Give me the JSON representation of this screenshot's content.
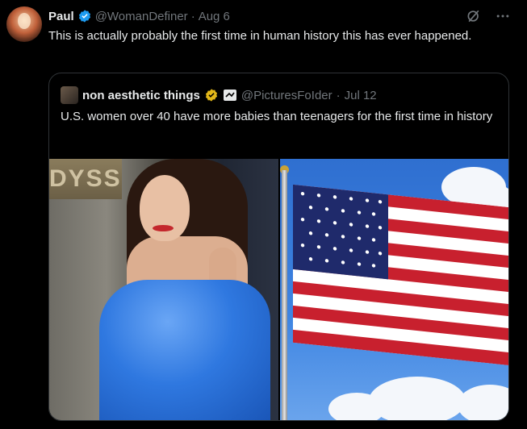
{
  "tweet": {
    "name": "Paul",
    "handle": "@WomanDefiner",
    "separator": "·",
    "date": "Aug 6",
    "text": "This is actually probably the first time in human history this has ever happened."
  },
  "quote": {
    "name": "non aesthetic things",
    "handle": "@PicturesFoIder",
    "separator": "·",
    "date": "Jul 12",
    "text": "U.S. women over 40 have more babies than teenagers for the first time in history",
    "sign_text": "DYSSEI"
  },
  "icons": {
    "verified_color_user": "#1d9bf0",
    "verified_color_quote": "#e2b719",
    "top_icons": [
      "grok-icon",
      "more-icon"
    ]
  }
}
